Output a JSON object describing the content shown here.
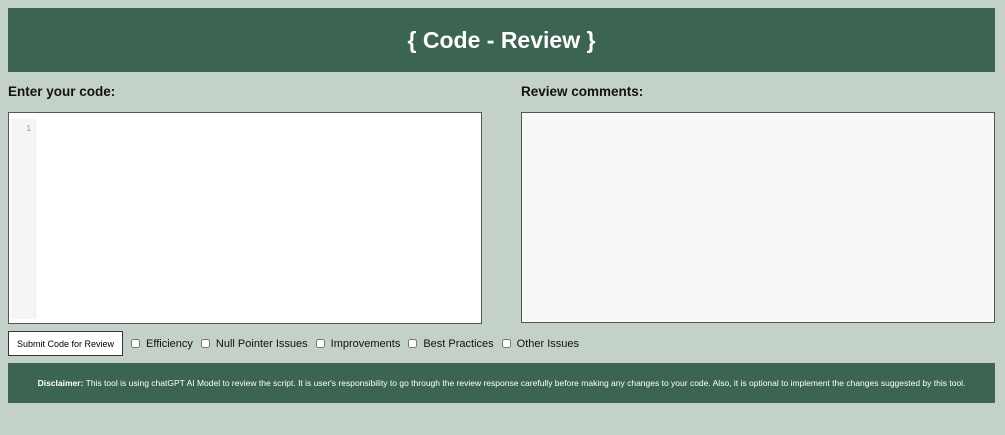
{
  "header": {
    "title": "{ Code - Review }"
  },
  "left": {
    "label": "Enter your code:",
    "line_number": "1",
    "code": ""
  },
  "right": {
    "label": "Review comments:",
    "content": ""
  },
  "submit_label": "Submit Code for Review",
  "options": [
    "Efficiency",
    "Null Pointer Issues",
    "Improvements",
    "Best Practices",
    "Other Issues"
  ],
  "footer": {
    "bold": "Disclaimer:",
    "text": " This tool is using chatGPT AI Model to review the script. It is user's responsibility to go through the review response carefully before making any changes to your code. Also, it is optional to implement the changes suggested by this tool."
  }
}
